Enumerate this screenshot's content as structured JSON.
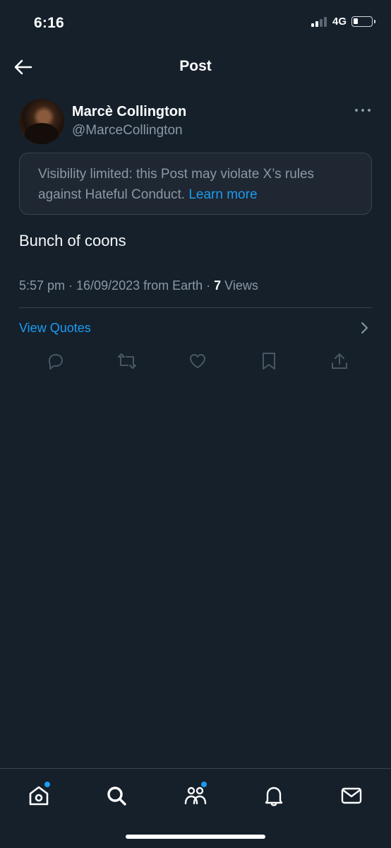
{
  "status_bar": {
    "time": "6:16",
    "network": "4G",
    "signal_bars_filled": 2,
    "signal_bars_total": 4
  },
  "header": {
    "title": "Post",
    "back_icon": "arrow-left-icon"
  },
  "post": {
    "display_name": "Marcè Collington",
    "handle": "@MarceCollington",
    "notice_text": "Visibility limited: this Post may violate X’s rules against Hateful Conduct.",
    "notice_link": "Learn more",
    "text": "Bunch of coons",
    "timestamp": "5:57 pm · 16/09/2023 from Earth · ",
    "views_count": "7",
    "views_label": " Views"
  },
  "quotes": {
    "label": "View Quotes"
  },
  "actions": [
    {
      "icon": "reply-icon"
    },
    {
      "icon": "repost-icon"
    },
    {
      "icon": "like-icon"
    },
    {
      "icon": "bookmark-icon"
    },
    {
      "icon": "share-icon"
    }
  ],
  "tabbar": [
    {
      "icon": "home-icon",
      "badge": true
    },
    {
      "icon": "search-icon",
      "badge": false
    },
    {
      "icon": "communities-icon",
      "badge": true
    },
    {
      "icon": "notifications-icon",
      "badge": false
    },
    {
      "icon": "messages-icon",
      "badge": false
    }
  ],
  "colors": {
    "background": "#15202b",
    "accent": "#1d9bf0",
    "secondary_text": "#8b98a5",
    "border": "#38444d"
  }
}
